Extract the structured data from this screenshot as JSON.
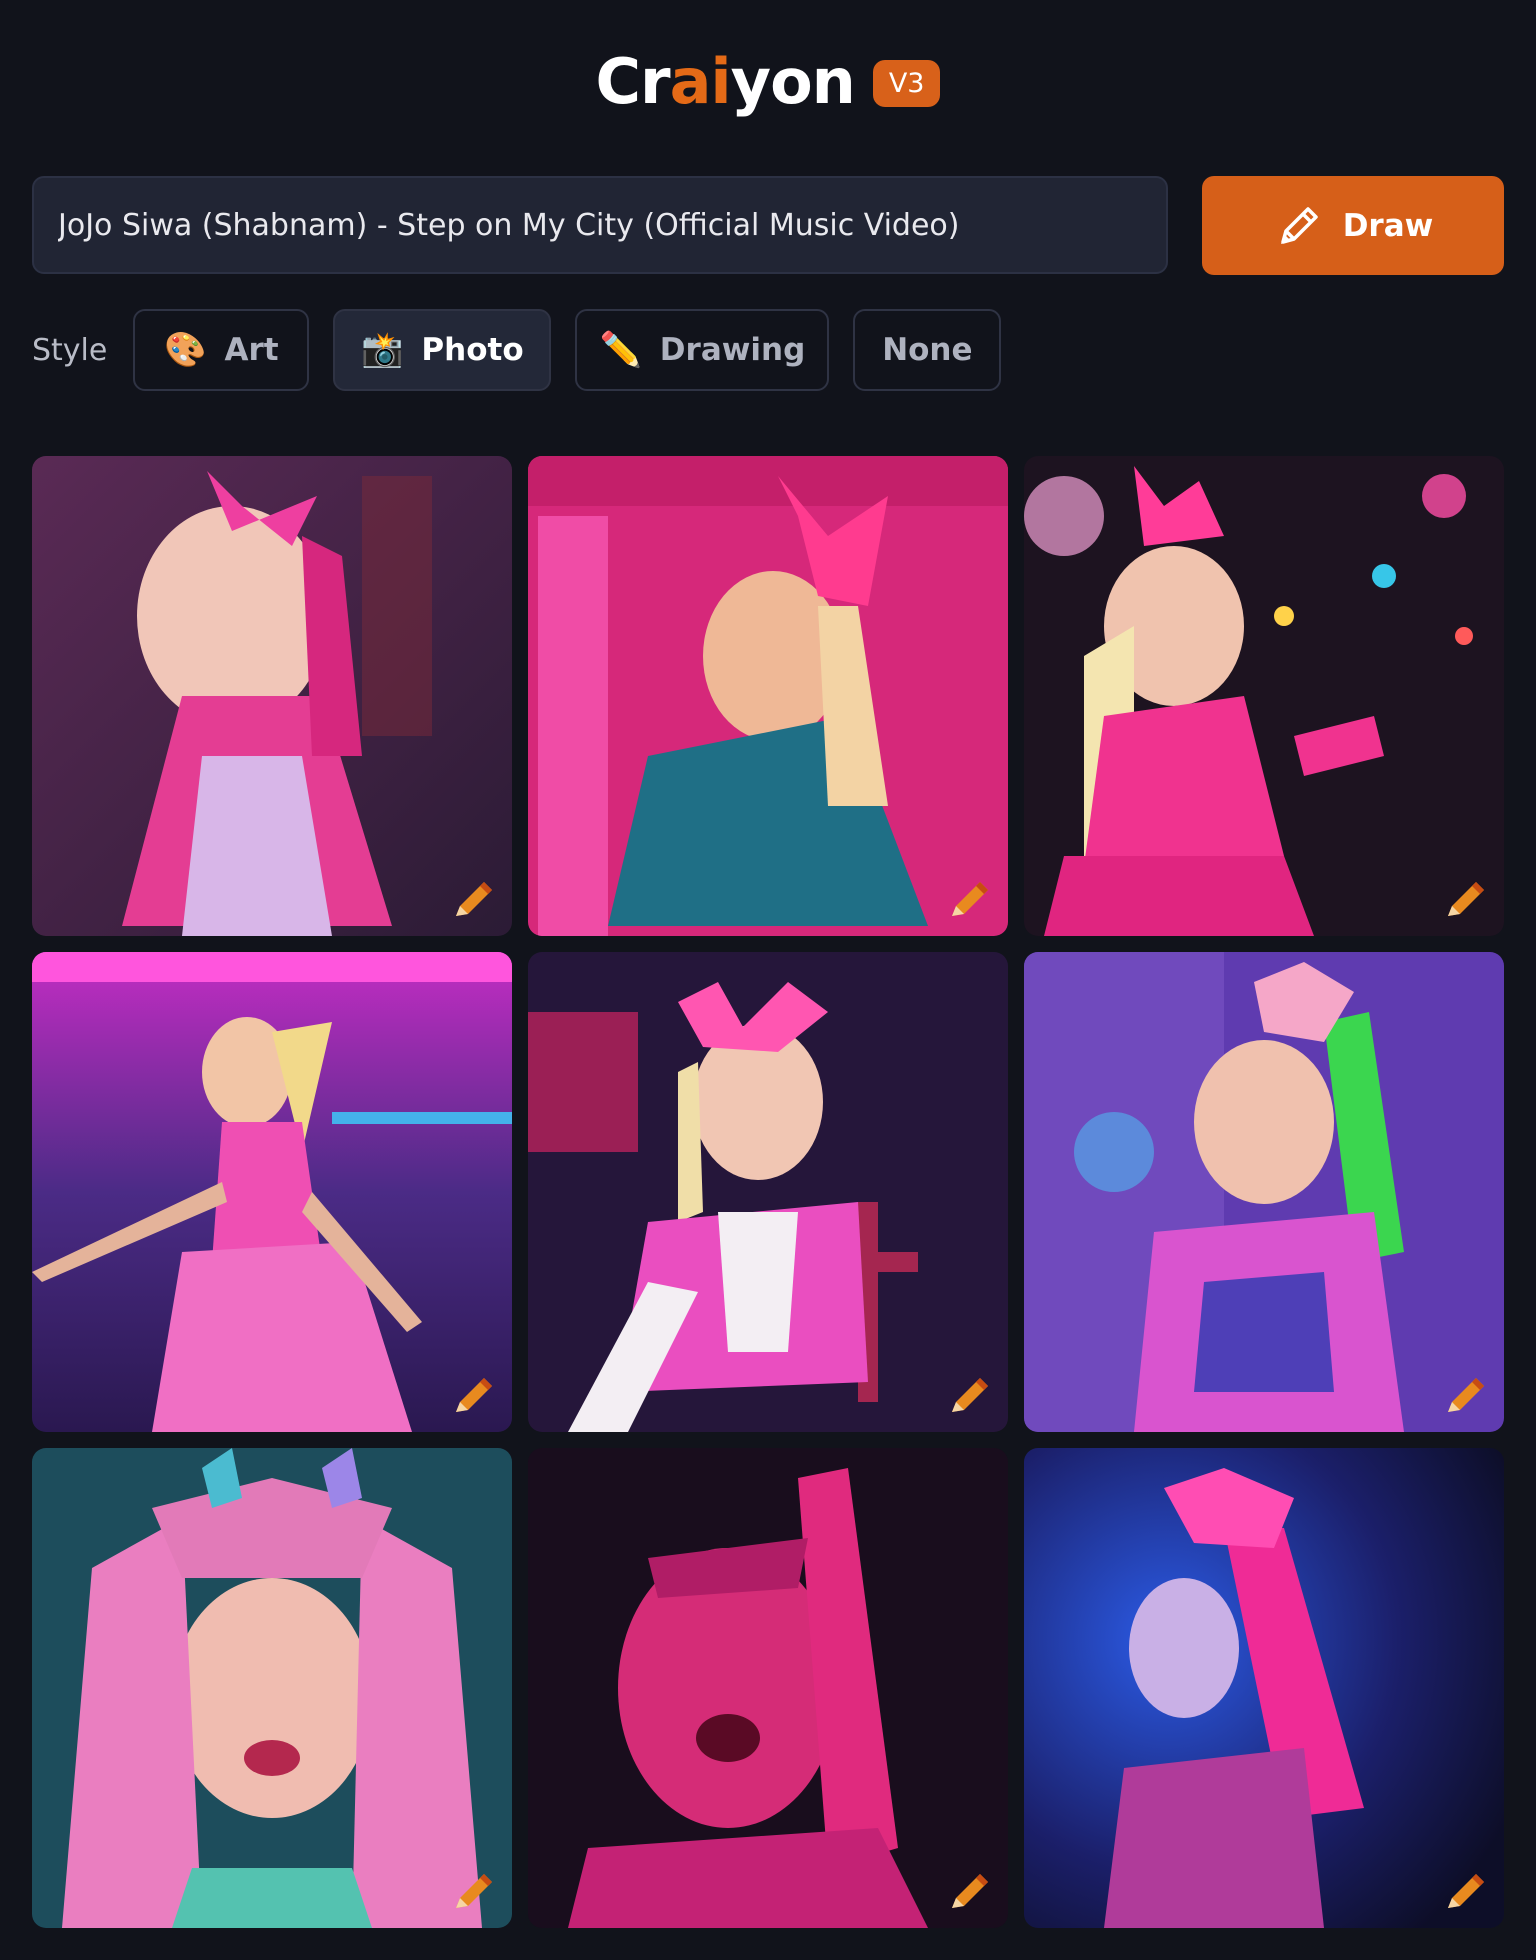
{
  "header": {
    "logo_prefix": "Cr",
    "logo_accent": "ai",
    "logo_suffix": "yon",
    "version_badge": "V3"
  },
  "prompt": {
    "value": "JoJo Siwa (Shabnam) - Step on My City (Official Music Video)"
  },
  "draw_button": {
    "label": "Draw",
    "icon": "pencil-icon"
  },
  "style": {
    "label": "Style",
    "options": [
      {
        "label": "Art",
        "icon": "palette-icon",
        "active": false
      },
      {
        "label": "Photo",
        "icon": "camera-flash-icon",
        "active": true
      },
      {
        "label": "Drawing",
        "icon": "pencil-icon",
        "active": false
      },
      {
        "label": "None",
        "icon": "",
        "active": false
      }
    ]
  },
  "results": {
    "count": 9,
    "tile_edit_icon": "pencil-edit-icon"
  },
  "colors": {
    "background": "#11131b",
    "accent": "#d65f19",
    "input_bg": "#212534"
  }
}
